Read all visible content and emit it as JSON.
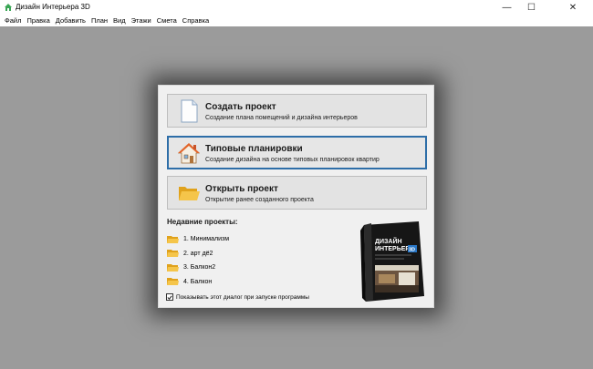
{
  "window": {
    "title": "Дизайн Интерьера 3D",
    "minimize_glyph": "—",
    "maximize_glyph": "☐",
    "close_glyph": "✕"
  },
  "menu": [
    "Файл",
    "Правка",
    "Добавить",
    "План",
    "Вид",
    "Этажи",
    "Смета",
    "Справка"
  ],
  "dialog": {
    "actions": [
      {
        "title": "Создать проект",
        "subtitle": "Создание плана помещений и дизайна интерьеров",
        "icon": "blank-document-icon"
      },
      {
        "title": "Типовые планировки",
        "subtitle": "Создание дизайна на основе типовых планировок квартир",
        "icon": "house-icon"
      },
      {
        "title": "Открыть проект",
        "subtitle": "Открытие ранее созданного проекта",
        "icon": "open-folder-icon"
      }
    ],
    "recent_heading": "Недавние проекты:",
    "recent_projects": [
      "1. Минимализм",
      "2. арт дё2",
      "3. Балкон2",
      "4. Балкон"
    ],
    "show_on_startup_label": "Показывать этот диалог при запуске программы",
    "show_on_startup_checked": true,
    "product_box": {
      "title_line1": "ДИЗАЙН",
      "title_line2": "ИНТЕРЬЕРА",
      "badge": "3D"
    }
  },
  "colors": {
    "workspace": "#9b9b9b",
    "selected_border": "#2e6ea8",
    "folder": "#f2b72e"
  }
}
